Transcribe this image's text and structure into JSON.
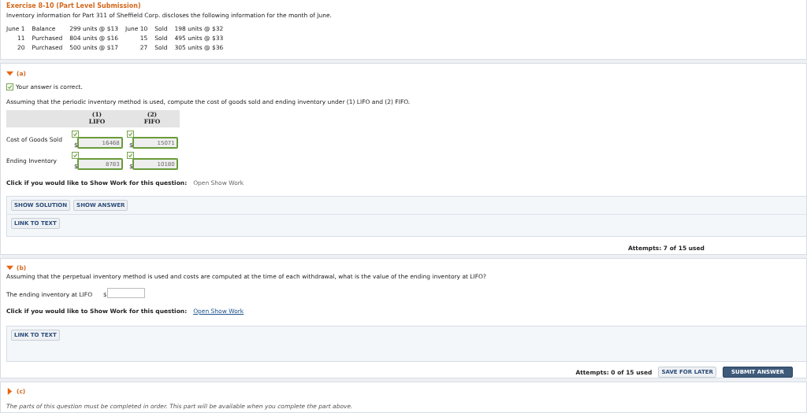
{
  "header": {
    "title": "Exercise 8-10 (Part Level Submission)",
    "intro": "Inventory information for Part 311 of Sheffield Corp. discloses the following information for the month of June.",
    "transactions": [
      {
        "date": "June 1",
        "type": "Balance",
        "detail": "299 units @ $13",
        "sale_date": "June 10",
        "sale_type": "Sold",
        "sale_detail": "198 units @ $32"
      },
      {
        "date": "11",
        "type": "Purchased",
        "detail": "804 units @ $16",
        "sale_date": "15",
        "sale_type": "Sold",
        "sale_detail": "495 units @ $33"
      },
      {
        "date": "20",
        "type": "Purchased",
        "detail": "500 units @ $17",
        "sale_date": "27",
        "sale_type": "Sold",
        "sale_detail": "305 units @ $36"
      }
    ]
  },
  "part_a": {
    "label": "(a)",
    "expanded": true,
    "feedback": "Your answer is correct.",
    "correct": true,
    "question": "Assuming that the periodic inventory method is used, compute the cost of goods sold and ending inventory under (1) LIFO and (2) FIFO.",
    "columns": [
      {
        "number": "(1)",
        "name": "LIFO"
      },
      {
        "number": "(2)",
        "name": "FIFO"
      }
    ],
    "rows": [
      {
        "label": "Cost of Goods Sold",
        "cells": [
          {
            "currency": "$",
            "value": "16468",
            "correct": true
          },
          {
            "currency": "$",
            "value": "15071",
            "correct": true
          }
        ]
      },
      {
        "label": "Ending Inventory",
        "cells": [
          {
            "currency": "$",
            "value": "8783",
            "correct": true
          },
          {
            "currency": "$",
            "value": "10180",
            "correct": true
          }
        ]
      }
    ],
    "show_work_prompt": "Click if you would like to Show Work for this question:",
    "show_work_link": "Open Show Work",
    "show_work_enabled": false,
    "buttons": [
      "SHOW SOLUTION",
      "SHOW ANSWER"
    ],
    "link_button": "LINK TO TEXT",
    "attempts": "Attempts: 7 of 15 used"
  },
  "part_b": {
    "label": "(b)",
    "expanded": true,
    "question": "Assuming that the perpetual inventory method is used and costs are computed at the time of each withdrawal, what is the value of the ending inventory at LIFO?",
    "field_label": "The ending inventory at LIFO",
    "currency": "$",
    "show_work_prompt": "Click if you would like to Show Work for this question:",
    "show_work_link": "Open Show Work",
    "show_work_enabled": true,
    "link_button": "LINK TO TEXT",
    "attempts": "Attempts: 0 of 15 used",
    "save_button": "SAVE FOR LATER",
    "submit_button": "SUBMIT ANSWER"
  },
  "part_c": {
    "label": "(c)",
    "expanded": false,
    "note": "The parts of this question must be completed in order. This part will be available when you complete the part above."
  }
}
